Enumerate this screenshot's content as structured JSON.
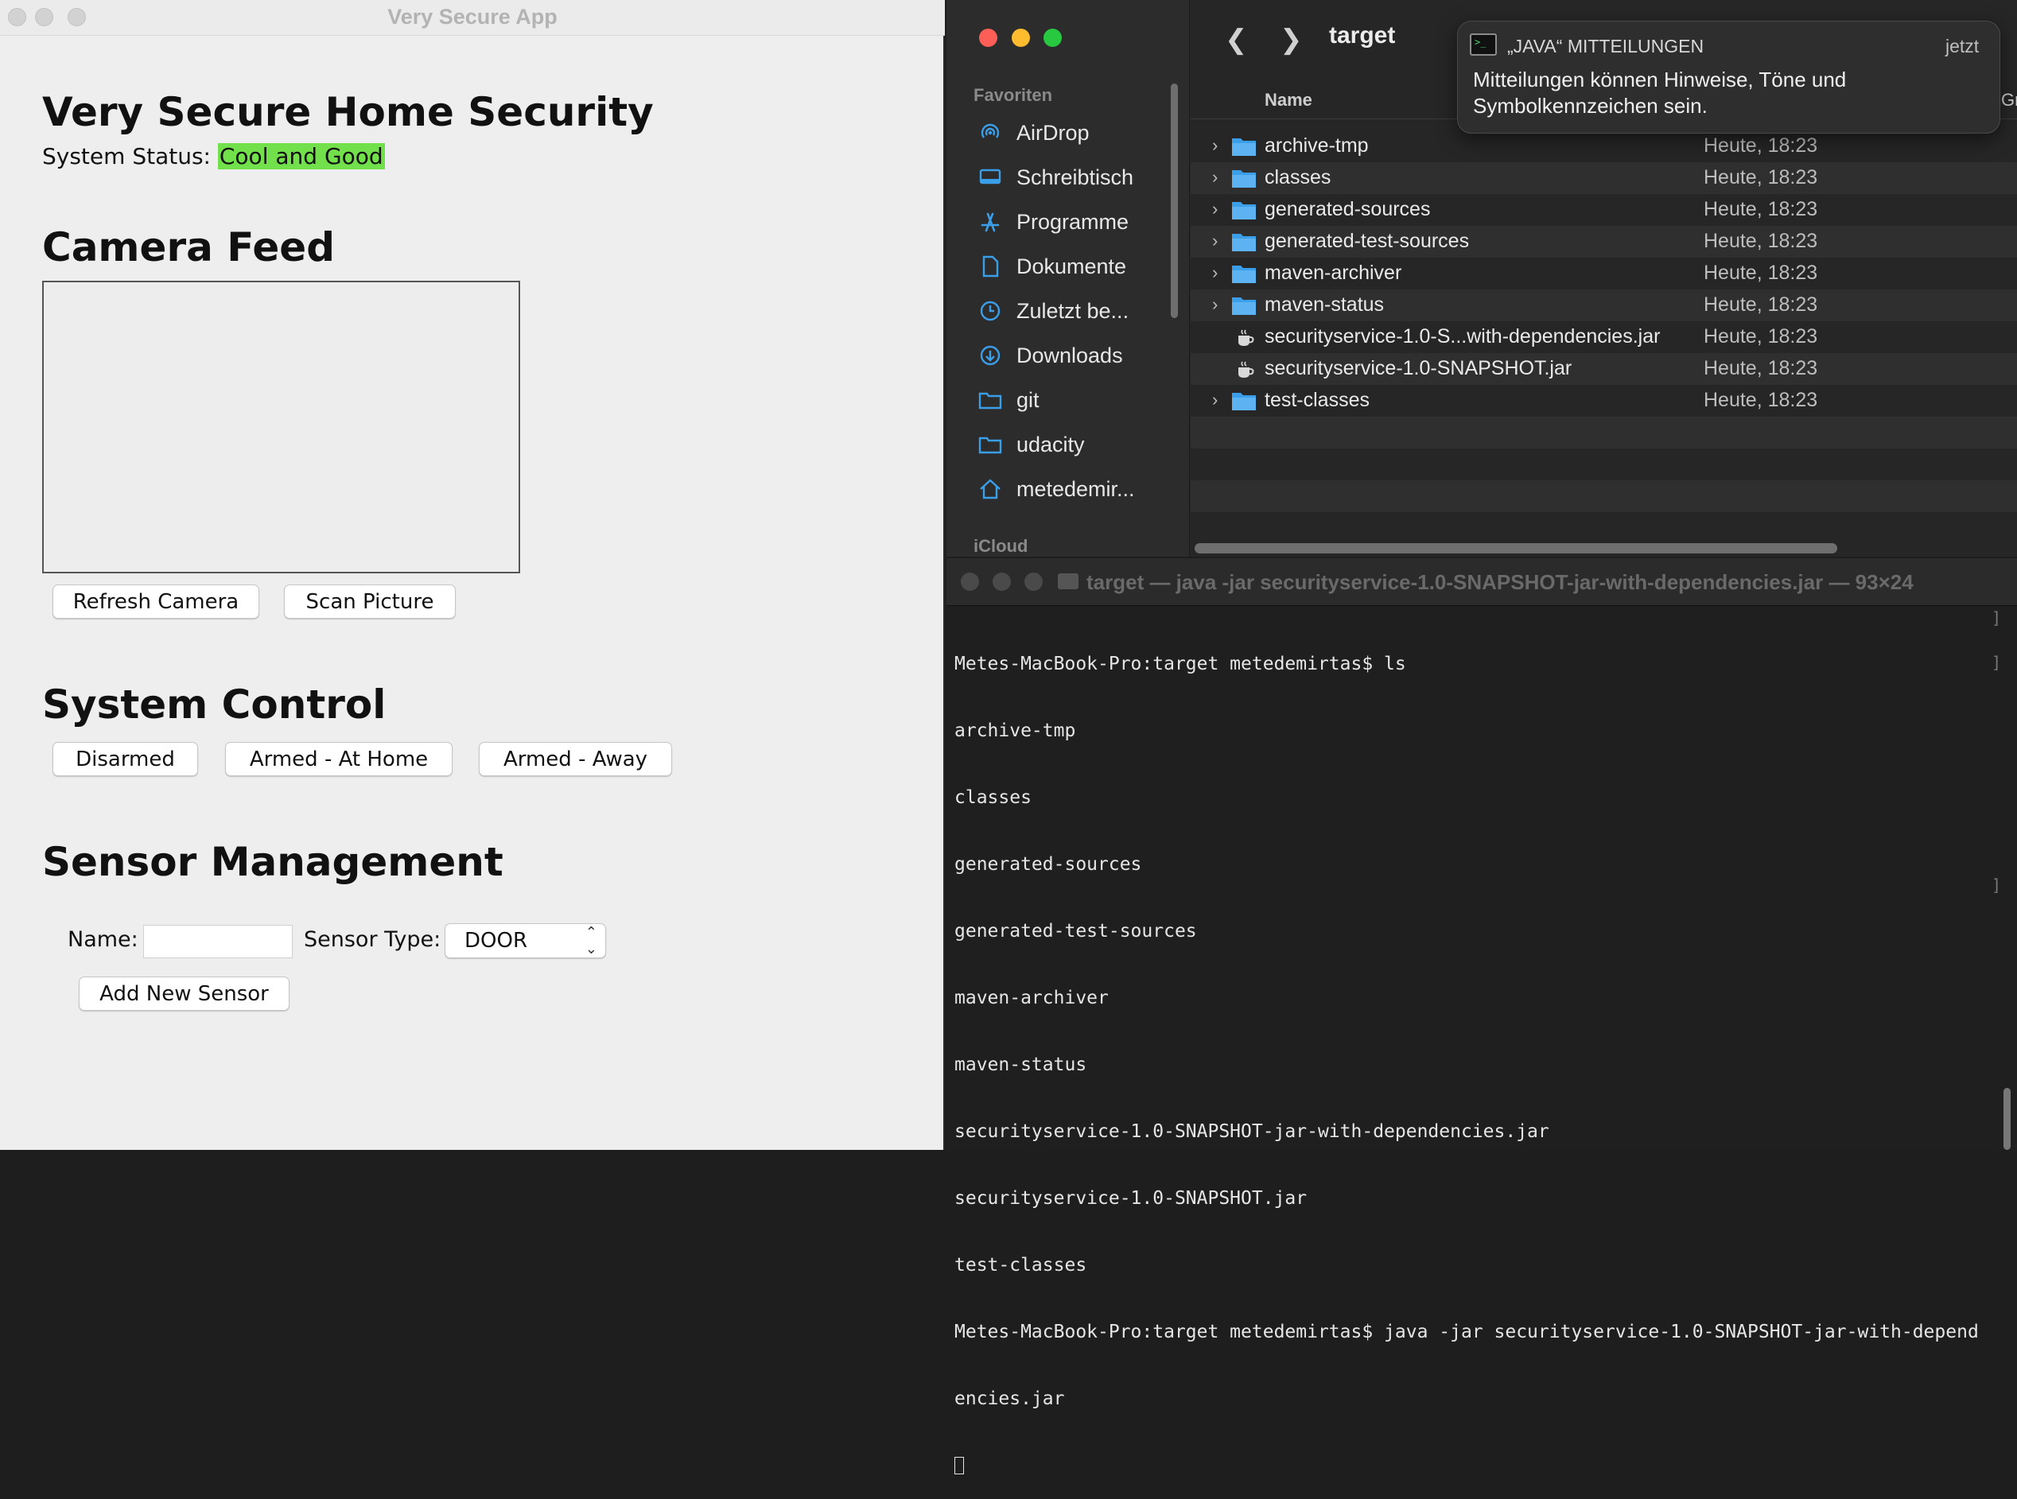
{
  "java_app": {
    "window_title": "Very Secure App",
    "heading": "Very Secure Home Security",
    "status_label": "System Status: ",
    "status_value": "Cool and Good",
    "status_color": "#71e04b",
    "camera_heading": "Camera Feed",
    "refresh_camera": "Refresh Camera",
    "scan_picture": "Scan Picture",
    "control_heading": "System Control",
    "disarmed": "Disarmed",
    "armed_home": "Armed - At Home",
    "armed_away": "Armed - Away",
    "sensor_heading": "Sensor Management",
    "name_label": "Name:",
    "name_value": "",
    "type_label": "Sensor Type:",
    "type_value": "DOOR",
    "add_sensor": "Add New Sensor"
  },
  "finder": {
    "title": "target",
    "favorites_header": "Favoriten",
    "icloud_header": "iCloud",
    "sidebar_items": [
      {
        "label": "AirDrop",
        "icon": "airdrop-icon"
      },
      {
        "label": "Schreibtisch",
        "icon": "desktop-icon"
      },
      {
        "label": "Programme",
        "icon": "applications-icon"
      },
      {
        "label": "Dokumente",
        "icon": "document-icon"
      },
      {
        "label": "Zuletzt be...",
        "icon": "clock-icon"
      },
      {
        "label": "Downloads",
        "icon": "download-icon"
      },
      {
        "label": "git",
        "icon": "folder-icon"
      },
      {
        "label": "udacity",
        "icon": "folder-icon"
      },
      {
        "label": "metedemir...",
        "icon": "home-icon"
      }
    ],
    "column_name": "Name",
    "column_extra": "Grö",
    "files": [
      {
        "name": "archive-tmp",
        "date": "Heute, 18:23",
        "kind": "folder"
      },
      {
        "name": "classes",
        "date": "Heute, 18:23",
        "kind": "folder"
      },
      {
        "name": "generated-sources",
        "date": "Heute, 18:23",
        "kind": "folder"
      },
      {
        "name": "generated-test-sources",
        "date": "Heute, 18:23",
        "kind": "folder"
      },
      {
        "name": "maven-archiver",
        "date": "Heute, 18:23",
        "kind": "folder"
      },
      {
        "name": "maven-status",
        "date": "Heute, 18:23",
        "kind": "folder"
      },
      {
        "name": "securityservice-1.0-S...with-dependencies.jar",
        "date": "Heute, 18:23",
        "kind": "jar"
      },
      {
        "name": "securityservice-1.0-SNAPSHOT.jar",
        "date": "Heute, 18:23",
        "kind": "jar"
      },
      {
        "name": "test-classes",
        "date": "Heute, 18:23",
        "kind": "folder"
      }
    ],
    "accent_color": "#3a9ee8"
  },
  "notification": {
    "app_name": "„JAVA“ MITTEILUNGEN",
    "time": "jetzt",
    "body": "Mitteilungen können Hinweise, Töne und Symbolkennzeichen sein."
  },
  "terminal": {
    "title": "target — java -jar securityservice-1.0-SNAPSHOT-jar-with-dependencies.jar — 93×24",
    "lines": [
      "Metes-MacBook-Pro:target metedemirtas$ ls",
      "archive-tmp",
      "classes",
      "generated-sources",
      "generated-test-sources",
      "maven-archiver",
      "maven-status",
      "securityservice-1.0-SNAPSHOT-jar-with-dependencies.jar",
      "securityservice-1.0-SNAPSHOT.jar",
      "test-classes",
      "Metes-MacBook-Pro:target metedemirtas$ java -jar securityservice-1.0-SNAPSHOT-jar-with-depend",
      "encies.jar"
    ]
  }
}
